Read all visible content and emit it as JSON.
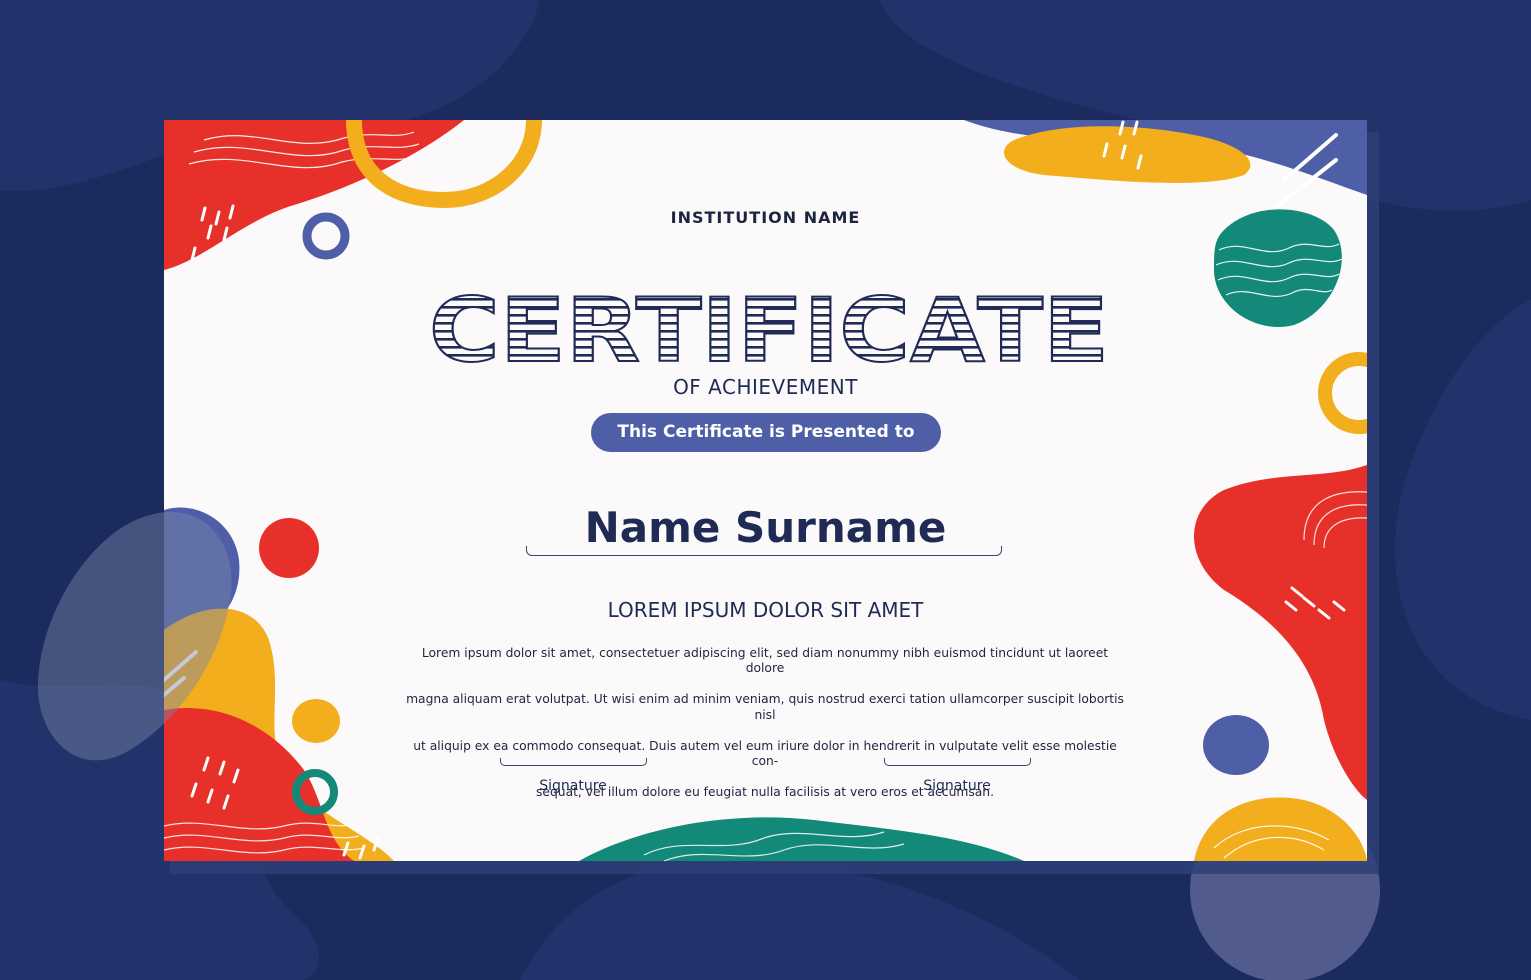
{
  "certificate": {
    "institution_name": "INSTITUTION NAME",
    "title": "CERTIFICATE",
    "subtitle": "OF ACHIEVEMENT",
    "presented_to": "This Certificate is Presented to",
    "recipient_name": "Name Surname",
    "heading": "LOREM IPSUM DOLOR SIT AMET",
    "body_lines": [
      "Lorem ipsum dolor sit amet, consectetuer adipiscing elit, sed diam nonummy nibh euismod tincidunt ut laoreet dolore",
      "magna aliquam erat volutpat. Ut wisi enim ad minim veniam, quis nostrud exerci tation ullamcorper suscipit lobortis nisl",
      "ut aliquip ex ea commodo consequat. Duis autem vel eum iriure dolor in hendrerit in vulputate velit esse molestie con-",
      "sequat, vel illum dolore eu feugiat nulla facilisis at vero eros et accumsan."
    ],
    "signatures": [
      {
        "label": "Signature"
      },
      {
        "label": "Signature"
      }
    ]
  },
  "colors": {
    "background": "#1c2b5e",
    "navy": "#1f2b55",
    "blue": "#4e5fa8",
    "red": "#e8302a",
    "yellow": "#f2ae1c",
    "teal": "#13897a"
  }
}
